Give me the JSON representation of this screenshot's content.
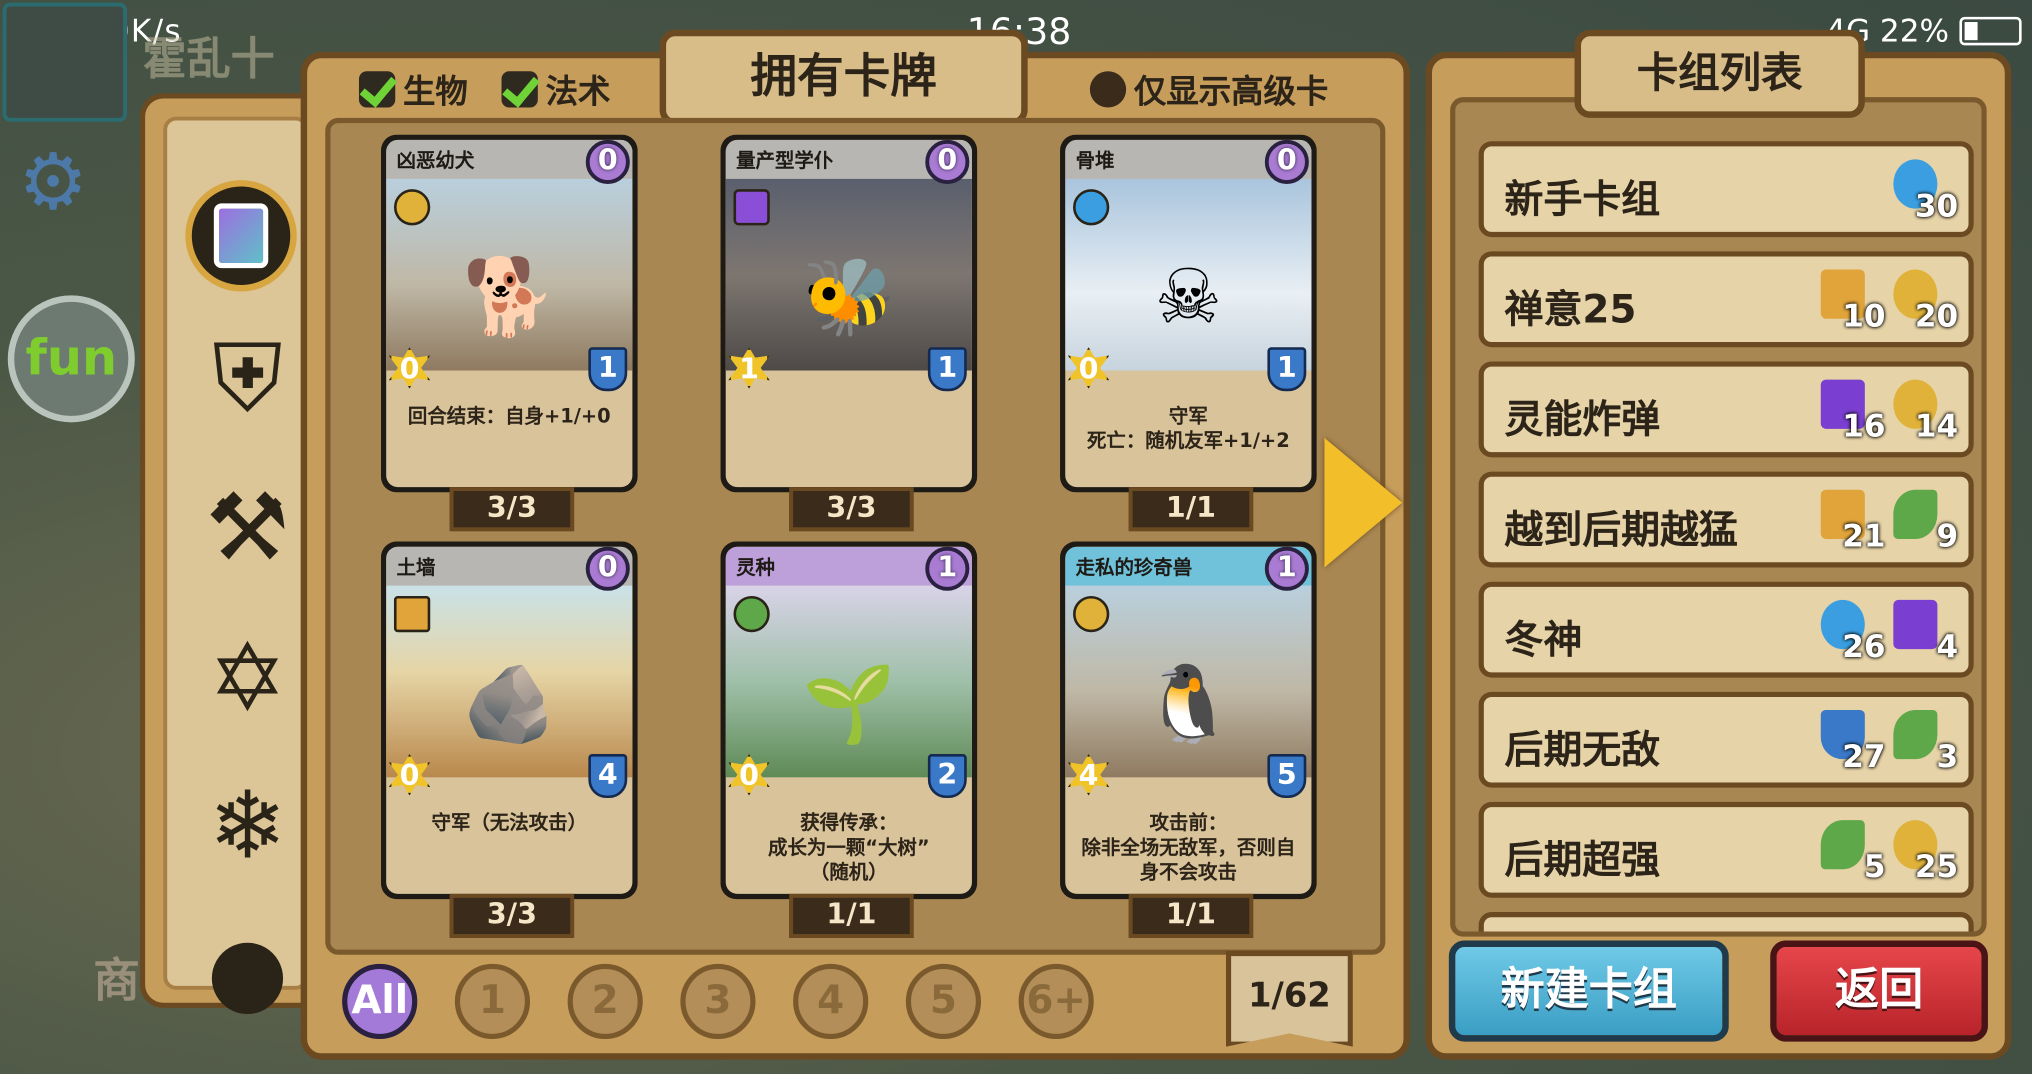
{
  "status_bar": {
    "left": "4G  G  0K/s",
    "time": "16:38",
    "right": "4G  22%"
  },
  "background_title": "霍乱十",
  "fun_logo": "fun",
  "shop_label": "商",
  "panel_title": "拥有卡牌",
  "filters": {
    "creature": "生物",
    "spell": "法术",
    "premium_only": "仅显示高级卡"
  },
  "cards": [
    {
      "name": "凶恶幼犬",
      "cost": "0",
      "attack": "0",
      "health": "1",
      "desc": "回合结束：自身+1/+0",
      "count": "3/3",
      "tribe": "anchor",
      "name_color": "gray",
      "art": "port",
      "creature_icon": "dog"
    },
    {
      "name": "量产型学仆",
      "cost": "0",
      "attack": "1",
      "health": "1",
      "desc": "",
      "count": "3/3",
      "tribe": "book",
      "name_color": "gray",
      "art": "hall",
      "creature_icon": "insect"
    },
    {
      "name": "骨堆",
      "cost": "0",
      "attack": "0",
      "health": "1",
      "desc": "守军\n死亡：随机友军+1/+2",
      "count": "1/1",
      "tribe": "snow",
      "name_color": "gray",
      "art": "snow",
      "creature_icon": "bones"
    },
    {
      "name": "土墙",
      "cost": "0",
      "attack": "0",
      "health": "4",
      "desc": "守军（无法攻击）",
      "count": "3/3",
      "tribe": "axe",
      "name_color": "gray",
      "art": "desert",
      "creature_icon": "rock"
    },
    {
      "name": "灵种",
      "cost": "1",
      "attack": "0",
      "health": "2",
      "desc": "获得传承：\n成长为一颗“大树”\n（随机）",
      "count": "1/1",
      "tribe": "leaf",
      "name_color": "purple",
      "art": "forest",
      "creature_icon": "sprout"
    },
    {
      "name": "走私的珍奇兽",
      "cost": "1",
      "attack": "4",
      "health": "5",
      "desc": "攻击前：\n除非全场无敌军，否则自身不会攻击",
      "count": "1/1",
      "tribe": "anchor",
      "name_color": "cyan",
      "art": "port",
      "creature_icon": "yeti"
    }
  ],
  "cost_filters": [
    "All",
    "1",
    "2",
    "3",
    "4",
    "5",
    "6+"
  ],
  "page_indicator": "1/62",
  "deck_panel_title": "卡组列表",
  "decks": [
    {
      "name": "新手卡组",
      "badges": [
        {
          "icon": "snow",
          "count": "30"
        }
      ]
    },
    {
      "name": "禅意25",
      "badges": [
        {
          "icon": "axe",
          "count": "10"
        },
        {
          "icon": "anchor",
          "count": "20"
        }
      ]
    },
    {
      "name": "灵能炸弹",
      "badges": [
        {
          "icon": "book",
          "count": "16"
        },
        {
          "icon": "anchor",
          "count": "14"
        }
      ]
    },
    {
      "name": "越到后期越猛",
      "badges": [
        {
          "icon": "axe",
          "count": "21"
        },
        {
          "icon": "leaf",
          "count": "9"
        }
      ]
    },
    {
      "name": "冬神",
      "badges": [
        {
          "icon": "snow",
          "count": "26"
        },
        {
          "icon": "book",
          "count": "4"
        }
      ]
    },
    {
      "name": "后期无敌",
      "badges": [
        {
          "icon": "shield",
          "count": "27"
        },
        {
          "icon": "leaf",
          "count": "3"
        }
      ]
    },
    {
      "name": "后期超强",
      "badges": [
        {
          "icon": "leaf",
          "count": "5"
        },
        {
          "icon": "anchor",
          "count": "25"
        }
      ]
    }
  ],
  "buttons": {
    "new_deck": "新建卡组",
    "back": "返回"
  }
}
